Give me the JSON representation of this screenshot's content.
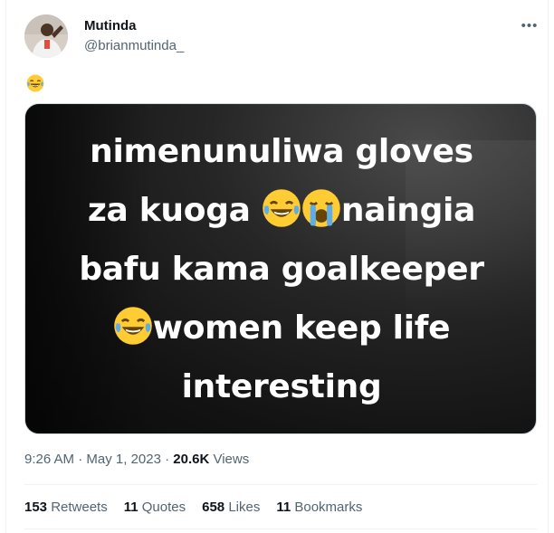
{
  "user": {
    "name": "Mutinda",
    "handle": "@brianmutinda_"
  },
  "tweet": {
    "text": "😂"
  },
  "media": {
    "caption_lines": [
      "nimenunuliwa gloves",
      "za kuoga",
      "naingia",
      "bafu kama goalkeeper",
      "women keep life",
      "interesting"
    ]
  },
  "meta": {
    "time": "9:26 AM",
    "sep1": " · ",
    "date": "May 1, 2023",
    "sep2": " · ",
    "views_count": "20.6K",
    "views_label": " Views"
  },
  "stats": {
    "retweets_count": "153",
    "retweets_label": " Retweets",
    "quotes_count": "11",
    "quotes_label": " Quotes",
    "likes_count": "658",
    "likes_label": " Likes",
    "bookmarks_count": "11",
    "bookmarks_label": " Bookmarks"
  },
  "icons": {
    "more": "more-options-icon",
    "laugh": "face-with-tears-of-joy-icon",
    "cry": "loudly-crying-face-icon"
  },
  "colors": {
    "text_primary": "#0f1419",
    "text_secondary": "#536471",
    "emoji_yellow": "#ffcc33"
  }
}
